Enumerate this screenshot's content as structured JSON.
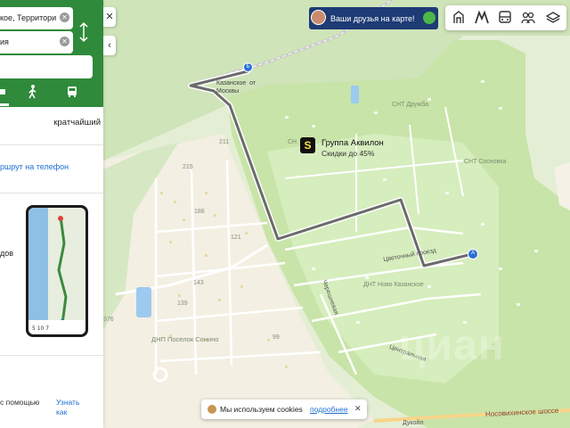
{
  "route": {
    "from_value": "кое, Территори",
    "to_value": "ия",
    "route_type": "кратчайший",
    "send_link": "ршрут на телефон",
    "promo_text": "дов",
    "help_text": "с помощью",
    "learn_more": "Узнать как",
    "modes": [
      "car-icon",
      "walk-icon",
      "bus-icon"
    ]
  },
  "banner": {
    "friends_text": "Ваши друзья на карте!"
  },
  "toolbar": {
    "tools": [
      "geo-layer-icon",
      "metro-icon",
      "transport-icon",
      "people-icon",
      "layers-icon"
    ]
  },
  "map": {
    "labels": {
      "station": "Казанское  от\nМосквы",
      "snt_druzhba": "СНТ Дружба",
      "snt_sosnovka": "СНТ Сосновка",
      "snt_short": "СН",
      "dnp_sonino": "ДНП Поселок Сонино",
      "dnt_novo": "ДНТ Ново Казанское",
      "tsvetochny": "Цветочный проезд",
      "chereshnevaya": "Черешневая",
      "tsentralnaya": "Центральная",
      "highway": "Носовихинское шоссе",
      "dukoil": "Дукойл"
    },
    "plots": [
      "211",
      "215",
      "188",
      "121",
      "143",
      "139",
      "99",
      "376"
    ],
    "poi": {
      "icon": "S",
      "title": "Группа Аквилон",
      "subtitle": "Скидки до 45%"
    },
    "markers": {
      "start": "А",
      "finish": "Б"
    },
    "watermark": "циан"
  },
  "cookie": {
    "text": "Мы используем cookies",
    "link": "подробнее",
    "close": "✕"
  },
  "colors": {
    "route_green": "#2f8a3b",
    "route_line": "#6b6b6b",
    "marker_blue": "#2a6fd6",
    "park_green": "#cfe7b5"
  }
}
